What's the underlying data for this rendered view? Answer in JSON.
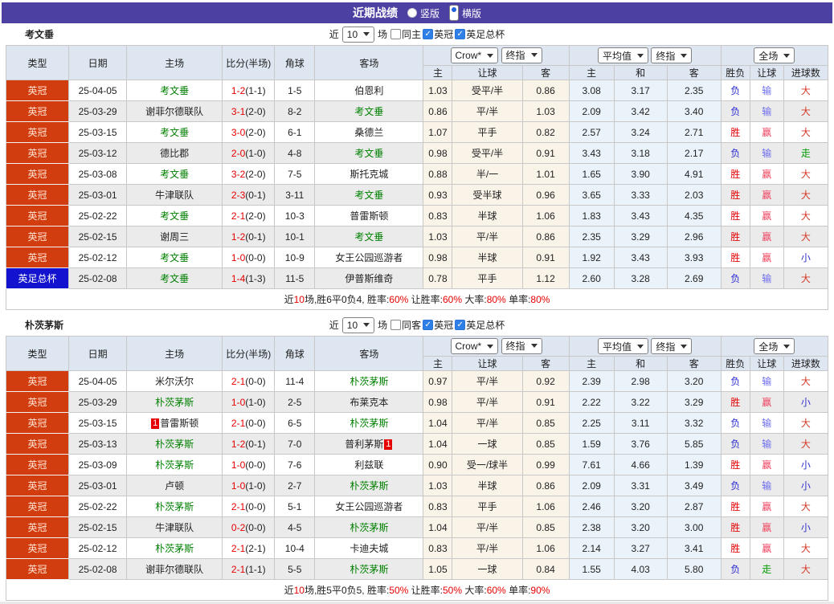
{
  "title_bar": {
    "title": "近期战绩",
    "radios": [
      {
        "label": "竖版",
        "selected": false
      },
      {
        "label": "横版",
        "selected": true
      }
    ]
  },
  "shared": {
    "filter": {
      "near": "近",
      "games": "场"
    },
    "columns": [
      "类型",
      "日期",
      "主场",
      "比分(半场)",
      "角球",
      "客场"
    ],
    "selects": {
      "odds1": "Crow*",
      "odds2": "终指",
      "avg1": "平均值",
      "avg2": "终指",
      "scope": "全场"
    },
    "sub_columns": [
      "主",
      "让球",
      "客",
      "主",
      "和",
      "客",
      "胜负",
      "让球",
      "进球数"
    ]
  },
  "colors": {
    "accent_purple": "#4c41a3",
    "league_bg": "#d23d0f",
    "cup_bg": "#1212cf",
    "team_green": "#008000",
    "score_red": "#e60000",
    "summary_red": "#e60000",
    "result_map": {
      "胜": "#e60000",
      "负": "#2b2bd5",
      "赢": "#f0425e",
      "输": "#6b6bef",
      "走": "#009a00",
      "大": "#d43a2a",
      "小": "#3434cf"
    }
  },
  "sections": [
    {
      "team": "考文垂",
      "filter": {
        "count": "10",
        "checks": [
          {
            "label": "同主",
            "checked": false
          },
          {
            "label": "英冠",
            "checked": true
          },
          {
            "label": "英足总杯",
            "checked": true
          }
        ]
      },
      "rows": [
        {
          "league": "英冠",
          "cup": false,
          "date": "25-04-05",
          "home": "考文垂",
          "home_green": true,
          "home_badge": "",
          "score": "1-2",
          "half": "(1-1)",
          "corner": "1-5",
          "away": "伯恩利",
          "away_green": false,
          "away_badge": "",
          "o": [
            "1.03",
            "受平/半",
            "0.86"
          ],
          "avg": [
            "3.08",
            "3.17",
            "2.35"
          ],
          "res": [
            "负",
            "输",
            "大"
          ]
        },
        {
          "league": "英冠",
          "cup": false,
          "date": "25-03-29",
          "home": "谢菲尔德联队",
          "home_green": false,
          "home_badge": "",
          "score": "3-1",
          "half": "(2-0)",
          "corner": "8-2",
          "away": "考文垂",
          "away_green": true,
          "away_badge": "",
          "o": [
            "0.86",
            "平/半",
            "1.03"
          ],
          "avg": [
            "2.09",
            "3.42",
            "3.40"
          ],
          "res": [
            "负",
            "输",
            "大"
          ]
        },
        {
          "league": "英冠",
          "cup": false,
          "date": "25-03-15",
          "home": "考文垂",
          "home_green": true,
          "home_badge": "",
          "score": "3-0",
          "half": "(2-0)",
          "corner": "6-1",
          "away": "桑德兰",
          "away_green": false,
          "away_badge": "",
          "o": [
            "1.07",
            "平手",
            "0.82"
          ],
          "avg": [
            "2.57",
            "3.24",
            "2.71"
          ],
          "res": [
            "胜",
            "赢",
            "大"
          ]
        },
        {
          "league": "英冠",
          "cup": false,
          "date": "25-03-12",
          "home": "德比郡",
          "home_green": false,
          "home_badge": "",
          "score": "2-0",
          "half": "(1-0)",
          "corner": "4-8",
          "away": "考文垂",
          "away_green": true,
          "away_badge": "",
          "o": [
            "0.98",
            "受平/半",
            "0.91"
          ],
          "avg": [
            "3.43",
            "3.18",
            "2.17"
          ],
          "res": [
            "负",
            "输",
            "走"
          ]
        },
        {
          "league": "英冠",
          "cup": false,
          "date": "25-03-08",
          "home": "考文垂",
          "home_green": true,
          "home_badge": "",
          "score": "3-2",
          "half": "(2-0)",
          "corner": "7-5",
          "away": "斯托克城",
          "away_green": false,
          "away_badge": "",
          "o": [
            "0.88",
            "半/一",
            "1.01"
          ],
          "avg": [
            "1.65",
            "3.90",
            "4.91"
          ],
          "res": [
            "胜",
            "赢",
            "大"
          ]
        },
        {
          "league": "英冠",
          "cup": false,
          "date": "25-03-01",
          "home": "牛津联队",
          "home_green": false,
          "home_badge": "",
          "score": "2-3",
          "half": "(0-1)",
          "corner": "3-11",
          "away": "考文垂",
          "away_green": true,
          "away_badge": "",
          "o": [
            "0.93",
            "受半球",
            "0.96"
          ],
          "avg": [
            "3.65",
            "3.33",
            "2.03"
          ],
          "res": [
            "胜",
            "赢",
            "大"
          ]
        },
        {
          "league": "英冠",
          "cup": false,
          "date": "25-02-22",
          "home": "考文垂",
          "home_green": true,
          "home_badge": "",
          "score": "2-1",
          "half": "(2-0)",
          "corner": "10-3",
          "away": "普雷斯顿",
          "away_green": false,
          "away_badge": "",
          "o": [
            "0.83",
            "半球",
            "1.06"
          ],
          "avg": [
            "1.83",
            "3.43",
            "4.35"
          ],
          "res": [
            "胜",
            "赢",
            "大"
          ]
        },
        {
          "league": "英冠",
          "cup": false,
          "date": "25-02-15",
          "home": "谢周三",
          "home_green": false,
          "home_badge": "",
          "score": "1-2",
          "half": "(0-1)",
          "corner": "10-1",
          "away": "考文垂",
          "away_green": true,
          "away_badge": "",
          "o": [
            "1.03",
            "平/半",
            "0.86"
          ],
          "avg": [
            "2.35",
            "3.29",
            "2.96"
          ],
          "res": [
            "胜",
            "赢",
            "大"
          ]
        },
        {
          "league": "英冠",
          "cup": false,
          "date": "25-02-12",
          "home": "考文垂",
          "home_green": true,
          "home_badge": "",
          "score": "1-0",
          "half": "(0-0)",
          "corner": "10-9",
          "away": "女王公园巡游者",
          "away_green": false,
          "away_badge": "",
          "o": [
            "0.98",
            "半球",
            "0.91"
          ],
          "avg": [
            "1.92",
            "3.43",
            "3.93"
          ],
          "res": [
            "胜",
            "赢",
            "小"
          ]
        },
        {
          "league": "英足总杯",
          "cup": true,
          "date": "25-02-08",
          "home": "考文垂",
          "home_green": true,
          "home_badge": "",
          "score": "1-4",
          "half": "(1-3)",
          "corner": "11-5",
          "away": "伊普斯维奇",
          "away_green": false,
          "away_badge": "",
          "o": [
            "0.78",
            "平手",
            "1.12"
          ],
          "avg": [
            "2.60",
            "3.28",
            "2.69"
          ],
          "res": [
            "负",
            "输",
            "大"
          ]
        }
      ],
      "summary_parts": [
        [
          "近",
          false
        ],
        [
          "10",
          true
        ],
        [
          "场,胜6平0负4, 胜率:",
          false
        ],
        [
          "60%",
          true
        ],
        [
          " 让胜率:",
          false
        ],
        [
          "60%",
          true
        ],
        [
          " 大率:",
          false
        ],
        [
          "80%",
          true
        ],
        [
          " 单率:",
          false
        ],
        [
          "80%",
          true
        ]
      ]
    },
    {
      "team": "朴茨茅斯",
      "filter": {
        "count": "10",
        "checks": [
          {
            "label": "同客",
            "checked": false
          },
          {
            "label": "英冠",
            "checked": true
          },
          {
            "label": "英足总杯",
            "checked": true
          }
        ]
      },
      "rows": [
        {
          "league": "英冠",
          "cup": false,
          "date": "25-04-05",
          "home": "米尔沃尔",
          "home_green": false,
          "home_badge": "",
          "score": "2-1",
          "half": "(0-0)",
          "corner": "11-4",
          "away": "朴茨茅斯",
          "away_green": true,
          "away_badge": "",
          "o": [
            "0.97",
            "平/半",
            "0.92"
          ],
          "avg": [
            "2.39",
            "2.98",
            "3.20"
          ],
          "res": [
            "负",
            "输",
            "大"
          ]
        },
        {
          "league": "英冠",
          "cup": false,
          "date": "25-03-29",
          "home": "朴茨茅斯",
          "home_green": true,
          "home_badge": "",
          "score": "1-0",
          "half": "(1-0)",
          "corner": "2-5",
          "away": "布莱克本",
          "away_green": false,
          "away_badge": "",
          "o": [
            "0.98",
            "平/半",
            "0.91"
          ],
          "avg": [
            "2.22",
            "3.22",
            "3.29"
          ],
          "res": [
            "胜",
            "赢",
            "小"
          ]
        },
        {
          "league": "英冠",
          "cup": false,
          "date": "25-03-15",
          "home": "普雷斯顿",
          "home_green": false,
          "home_badge": "1",
          "score": "2-1",
          "half": "(0-0)",
          "corner": "6-5",
          "away": "朴茨茅斯",
          "away_green": true,
          "away_badge": "",
          "o": [
            "1.04",
            "平/半",
            "0.85"
          ],
          "avg": [
            "2.25",
            "3.11",
            "3.32"
          ],
          "res": [
            "负",
            "输",
            "大"
          ]
        },
        {
          "league": "英冠",
          "cup": false,
          "date": "25-03-13",
          "home": "朴茨茅斯",
          "home_green": true,
          "home_badge": "",
          "score": "1-2",
          "half": "(0-1)",
          "corner": "7-0",
          "away": "普利茅斯",
          "away_green": false,
          "away_badge": "1",
          "o": [
            "1.04",
            "一球",
            "0.85"
          ],
          "avg": [
            "1.59",
            "3.76",
            "5.85"
          ],
          "res": [
            "负",
            "输",
            "大"
          ]
        },
        {
          "league": "英冠",
          "cup": false,
          "date": "25-03-09",
          "home": "朴茨茅斯",
          "home_green": true,
          "home_badge": "",
          "score": "1-0",
          "half": "(0-0)",
          "corner": "7-6",
          "away": "利兹联",
          "away_green": false,
          "away_badge": "",
          "o": [
            "0.90",
            "受一/球半",
            "0.99"
          ],
          "avg": [
            "7.61",
            "4.66",
            "1.39"
          ],
          "res": [
            "胜",
            "赢",
            "小"
          ]
        },
        {
          "league": "英冠",
          "cup": false,
          "date": "25-03-01",
          "home": "卢顿",
          "home_green": false,
          "home_badge": "",
          "score": "1-0",
          "half": "(1-0)",
          "corner": "2-7",
          "away": "朴茨茅斯",
          "away_green": true,
          "away_badge": "",
          "o": [
            "1.03",
            "半球",
            "0.86"
          ],
          "avg": [
            "2.09",
            "3.31",
            "3.49"
          ],
          "res": [
            "负",
            "输",
            "小"
          ]
        },
        {
          "league": "英冠",
          "cup": false,
          "date": "25-02-22",
          "home": "朴茨茅斯",
          "home_green": true,
          "home_badge": "",
          "score": "2-1",
          "half": "(0-0)",
          "corner": "5-1",
          "away": "女王公园巡游者",
          "away_green": false,
          "away_badge": "",
          "o": [
            "0.83",
            "平手",
            "1.06"
          ],
          "avg": [
            "2.46",
            "3.20",
            "2.87"
          ],
          "res": [
            "胜",
            "赢",
            "大"
          ]
        },
        {
          "league": "英冠",
          "cup": false,
          "date": "25-02-15",
          "home": "牛津联队",
          "home_green": false,
          "home_badge": "",
          "score": "0-2",
          "half": "(0-0)",
          "corner": "4-5",
          "away": "朴茨茅斯",
          "away_green": true,
          "away_badge": "",
          "o": [
            "1.04",
            "平/半",
            "0.85"
          ],
          "avg": [
            "2.38",
            "3.20",
            "3.00"
          ],
          "res": [
            "胜",
            "赢",
            "小"
          ]
        },
        {
          "league": "英冠",
          "cup": false,
          "date": "25-02-12",
          "home": "朴茨茅斯",
          "home_green": true,
          "home_badge": "",
          "score": "2-1",
          "half": "(2-1)",
          "corner": "10-4",
          "away": "卡迪夫城",
          "away_green": false,
          "away_badge": "",
          "o": [
            "0.83",
            "平/半",
            "1.06"
          ],
          "avg": [
            "2.14",
            "3.27",
            "3.41"
          ],
          "res": [
            "胜",
            "赢",
            "大"
          ]
        },
        {
          "league": "英冠",
          "cup": false,
          "date": "25-02-08",
          "home": "谢菲尔德联队",
          "home_green": false,
          "home_badge": "",
          "score": "2-1",
          "half": "(1-1)",
          "corner": "5-5",
          "away": "朴茨茅斯",
          "away_green": true,
          "away_badge": "",
          "o": [
            "1.05",
            "一球",
            "0.84"
          ],
          "avg": [
            "1.55",
            "4.03",
            "5.80"
          ],
          "res": [
            "负",
            "走",
            "大"
          ]
        }
      ],
      "summary_parts": [
        [
          "近",
          false
        ],
        [
          "10",
          true
        ],
        [
          "场,胜5平0负5, 胜率:",
          false
        ],
        [
          "50%",
          true
        ],
        [
          " 让胜率:",
          false
        ],
        [
          "50%",
          true
        ],
        [
          " 大率:",
          false
        ],
        [
          "60%",
          true
        ],
        [
          " 单率:",
          false
        ],
        [
          "90%",
          true
        ]
      ]
    }
  ]
}
